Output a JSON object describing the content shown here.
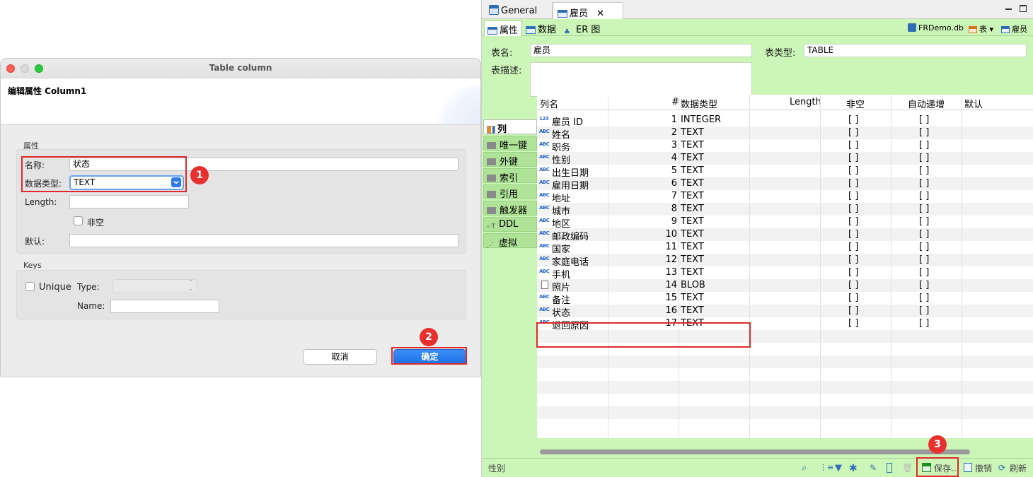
{
  "dialog": {
    "title": "Table column",
    "banner_title": "编辑属性 Column1",
    "group_properties": "属性",
    "name_label": "名称:",
    "name_value": "状态",
    "type_label": "数据类型:",
    "type_value": "TEXT",
    "length_label": "Length:",
    "length_value": "",
    "notnull_label": "非空",
    "default_label": "默认:",
    "default_value": "",
    "group_keys": "Keys",
    "unique_label": "Unique",
    "keytype_label": "Type:",
    "keyname_label": "Name:",
    "keyname_value": "",
    "cancel": "取消",
    "ok": "确定"
  },
  "badges": {
    "b1": "1",
    "b2": "2",
    "b3": "3"
  },
  "editor": {
    "top_tabs": [
      {
        "label": "General"
      },
      {
        "label": "雇员"
      }
    ],
    "sub_tabs": [
      {
        "label": "属性"
      },
      {
        "label": "数据"
      },
      {
        "label": "ER 图"
      }
    ],
    "db_name": "FRDemo.db",
    "tables_menu": "表",
    "current_table": "雇员",
    "table_name_label": "表名:",
    "table_name": "雇员",
    "table_type_label": "表类型:",
    "table_type": "TABLE",
    "table_desc_label": "表描述:",
    "table_desc": "",
    "nav": [
      {
        "label": "列"
      },
      {
        "label": "唯一键"
      },
      {
        "label": "外键"
      },
      {
        "label": "索引"
      },
      {
        "label": "引用"
      },
      {
        "label": "触发器"
      },
      {
        "label": "DDL"
      },
      {
        "label": "虚拟"
      }
    ],
    "columns_header": {
      "name": "列名",
      "num": "#",
      "type": "数据类型",
      "length": "Length",
      "notnull": "非空",
      "autoinc": "自动递增",
      "default": "默认"
    },
    "rows": [
      {
        "icon": "123",
        "name": "雇员 ID",
        "num": "1",
        "type": "INTEGER",
        "notnull": "[ ]",
        "autoinc": "[ ]"
      },
      {
        "icon": "ABC",
        "name": "姓名",
        "num": "2",
        "type": "TEXT",
        "notnull": "[ ]",
        "autoinc": "[ ]"
      },
      {
        "icon": "ABC",
        "name": "职务",
        "num": "3",
        "type": "TEXT",
        "notnull": "[ ]",
        "autoinc": "[ ]"
      },
      {
        "icon": "ABC",
        "name": "性别",
        "num": "4",
        "type": "TEXT",
        "notnull": "[ ]",
        "autoinc": "[ ]"
      },
      {
        "icon": "ABC",
        "name": "出生日期",
        "num": "5",
        "type": "TEXT",
        "notnull": "[ ]",
        "autoinc": "[ ]"
      },
      {
        "icon": "ABC",
        "name": "雇用日期",
        "num": "6",
        "type": "TEXT",
        "notnull": "[ ]",
        "autoinc": "[ ]"
      },
      {
        "icon": "ABC",
        "name": "地址",
        "num": "7",
        "type": "TEXT",
        "notnull": "[ ]",
        "autoinc": "[ ]"
      },
      {
        "icon": "ABC",
        "name": "城市",
        "num": "8",
        "type": "TEXT",
        "notnull": "[ ]",
        "autoinc": "[ ]"
      },
      {
        "icon": "ABC",
        "name": "地区",
        "num": "9",
        "type": "TEXT",
        "notnull": "[ ]",
        "autoinc": "[ ]"
      },
      {
        "icon": "ABC",
        "name": "邮政编码",
        "num": "10",
        "type": "TEXT",
        "notnull": "[ ]",
        "autoinc": "[ ]"
      },
      {
        "icon": "ABC",
        "name": "国家",
        "num": "11",
        "type": "TEXT",
        "notnull": "[ ]",
        "autoinc": "[ ]"
      },
      {
        "icon": "ABC",
        "name": "家庭电话",
        "num": "12",
        "type": "TEXT",
        "notnull": "[ ]",
        "autoinc": "[ ]"
      },
      {
        "icon": "ABC",
        "name": "手机",
        "num": "13",
        "type": "TEXT",
        "notnull": "[ ]",
        "autoinc": "[ ]"
      },
      {
        "icon": "img",
        "name": "照片",
        "num": "14",
        "type": "BLOB",
        "notnull": "[ ]",
        "autoinc": "[ ]"
      },
      {
        "icon": "ABC",
        "name": "备注",
        "num": "15",
        "type": "TEXT",
        "notnull": "[ ]",
        "autoinc": "[ ]"
      },
      {
        "icon": "ABC",
        "name": "状态",
        "num": "16",
        "type": "TEXT",
        "notnull": "[ ]",
        "autoinc": "[ ]"
      },
      {
        "icon": "ABC",
        "name": "退回原因",
        "num": "17",
        "type": "TEXT",
        "notnull": "[ ]",
        "autoinc": "[ ]"
      }
    ],
    "status_text": "性别",
    "save_label": "保存...",
    "revert_label": "撤销",
    "refresh_label": "刷新"
  }
}
